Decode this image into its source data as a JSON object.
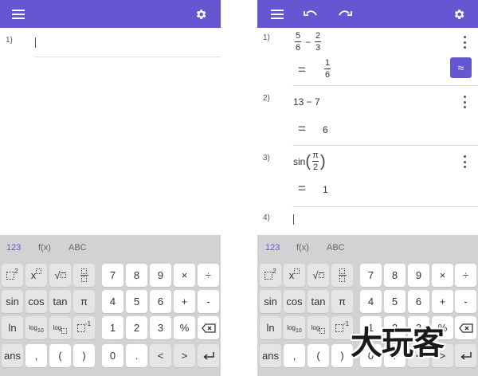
{
  "colors": {
    "accent": "#6557d2",
    "keyboard_bg": "#d2d2d4",
    "key_bg": "#ffffff"
  },
  "left": {
    "rows": [
      {
        "num": "1)"
      }
    ]
  },
  "right": {
    "rows": [
      {
        "num": "1)",
        "frac1_num": "5",
        "frac1_den": "6",
        "op": "−",
        "frac2_num": "2",
        "frac2_den": "3",
        "eq": "=",
        "res_num": "1",
        "res_den": "6",
        "approx": "≈"
      },
      {
        "num": "2)",
        "expr": "13 − 7",
        "eq": "=",
        "result": "6"
      },
      {
        "num": "3)",
        "fn": "sin",
        "arg_num": "π",
        "arg_den": "2",
        "eq": "=",
        "result": "1"
      },
      {
        "num": "4)"
      }
    ]
  },
  "keyboard": {
    "tabs": [
      "123",
      "f(x)",
      "ABC"
    ],
    "row1": {
      "k3": "π",
      "n7": "7",
      "n8": "8",
      "n9": "9",
      "times": "×",
      "divide": "÷",
      "x_label": "x"
    },
    "row2": {
      "sin": "sin",
      "cos": "cos",
      "tan": "tan",
      "pi": "π",
      "n4": "4",
      "n5": "5",
      "n6": "6",
      "plus": "+",
      "minus": "-"
    },
    "row3": {
      "ln": "ln",
      "log10": "log",
      "log10_sub": "10",
      "logb": "log",
      "n1": "1",
      "n2": "2",
      "n3": "3",
      "percent": "%"
    },
    "row4": {
      "ans": "ans",
      "comma": ",",
      "lparen": "(",
      "rparen": ")",
      "n0": "0",
      "dot": ".",
      "left": "<",
      "right": ">"
    },
    "sup_2": "2",
    "sup_m1": "-1"
  },
  "watermark": "大玩客"
}
